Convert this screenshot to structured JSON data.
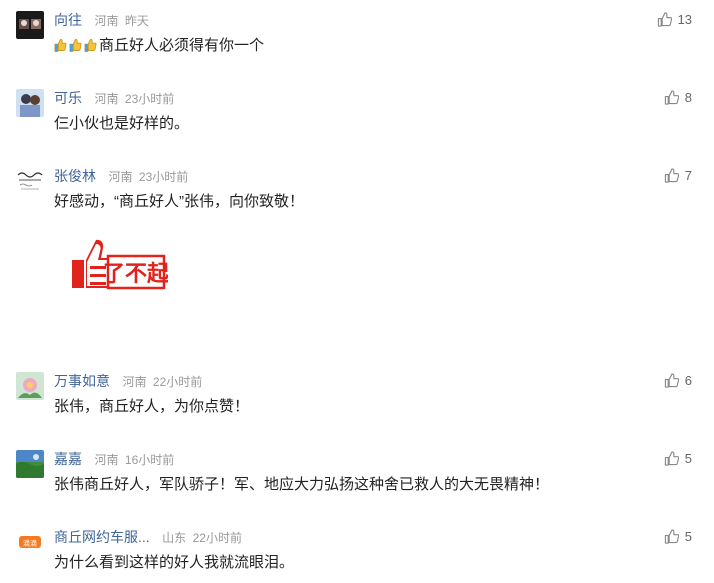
{
  "comments": [
    {
      "name": "向往",
      "location": "河南",
      "time": "昨天",
      "likes": "13",
      "text": "商丘好人必须得有你一个",
      "emoji_count": 3,
      "avatar": "dark-photo"
    },
    {
      "name": "可乐",
      "location": "河南",
      "time": "23小时前",
      "likes": "8",
      "text": "仨小伙也是好样的。",
      "avatar": "couple-photo"
    },
    {
      "name": "张俊林",
      "location": "河南",
      "time": "23小时前",
      "likes": "7",
      "text": "好感动，“商丘好人”张伟，向你致敬！",
      "avatar": "calligraphy",
      "sticker": "了不起"
    },
    {
      "name": "万事如意",
      "location": "河南",
      "time": "22小时前",
      "likes": "6",
      "text": "张伟，商丘好人，为你点赞！",
      "avatar": "flower"
    },
    {
      "name": "嘉嘉",
      "location": "河南",
      "time": "16小时前",
      "likes": "5",
      "text": "张伟商丘好人，军队骄子！军、地应大力弘扬这种舍已救人的大无畏精神！",
      "avatar": "landscape"
    },
    {
      "name": "商丘网约车服...",
      "location": "山东",
      "time": "22小时前",
      "likes": "5",
      "text": "为什么看到这样的好人我就流眼泪。",
      "avatar": "didi-logo",
      "avatar_text": "滴滴"
    }
  ],
  "colors": {
    "name": "#406599",
    "meta": "#999999",
    "text": "#222222",
    "sticker_red": "#e0231c"
  }
}
